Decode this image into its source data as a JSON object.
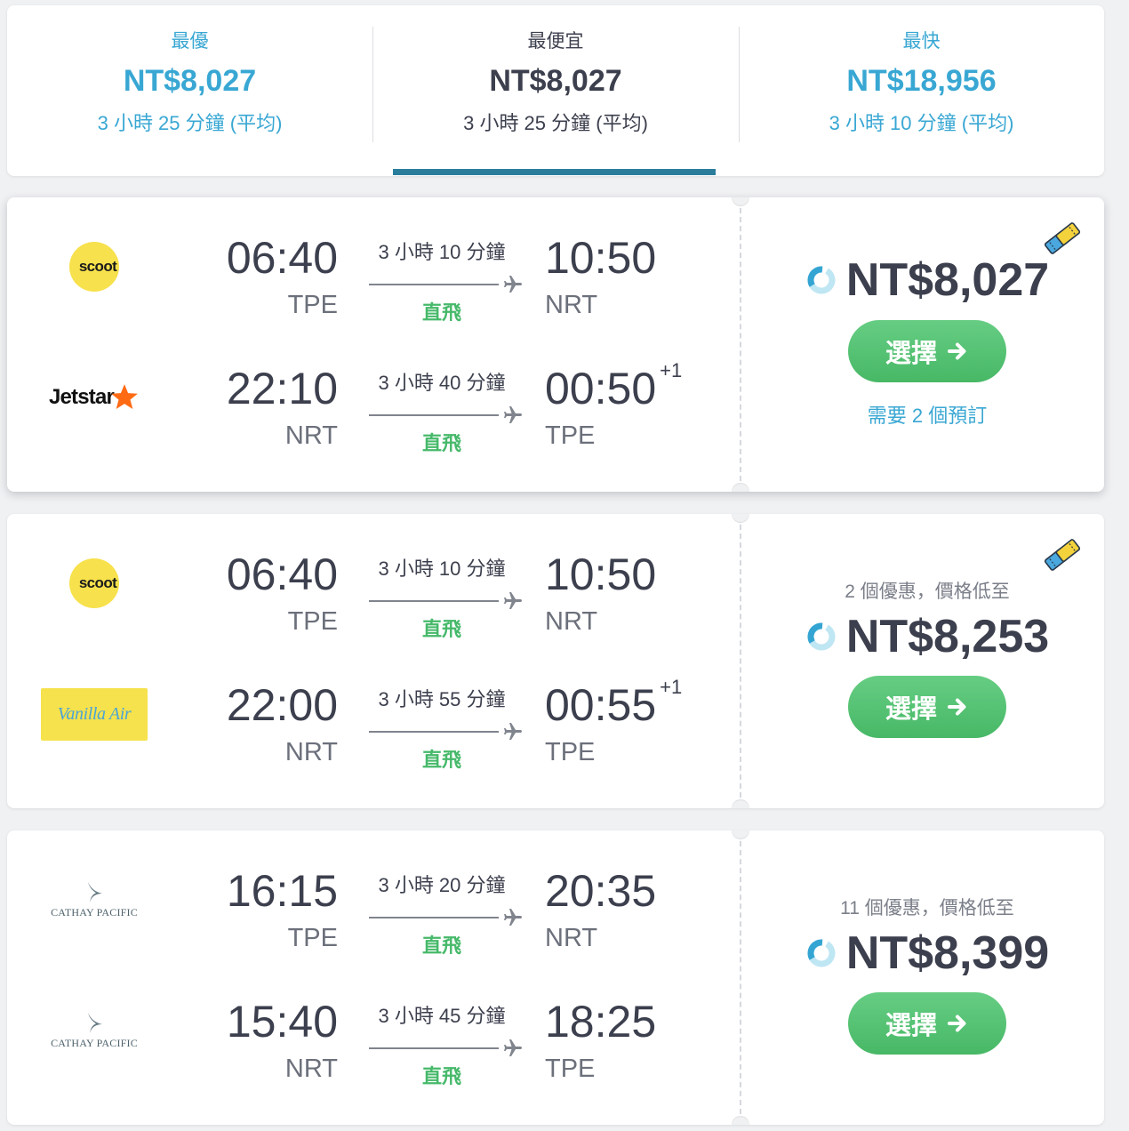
{
  "tabs": [
    {
      "label": "最優",
      "price": "NT$8,027",
      "duration": "3 小時 25 分鐘 (平均)",
      "active": false
    },
    {
      "label": "最便宜",
      "price": "NT$8,027",
      "duration": "3 小時 25 分鐘 (平均)",
      "active": true
    },
    {
      "label": "最快",
      "price": "NT$18,956",
      "duration": "3 小時 10 分鐘 (平均)",
      "active": false
    }
  ],
  "results": [
    {
      "legs": [
        {
          "airline": "scoot",
          "depart_time": "06:40",
          "depart_airport": "TPE",
          "duration": "3 小時 10 分鐘",
          "stops": "直飛",
          "arrive_time": "10:50",
          "arrive_airport": "NRT"
        },
        {
          "airline": "Jetstar",
          "depart_time": "22:10",
          "depart_airport": "NRT",
          "duration": "3 小時 40 分鐘",
          "stops": "直飛",
          "arrive_time": "00:50",
          "day_offset": "+1",
          "arrive_airport": "TPE"
        }
      ],
      "price": "NT$8,027",
      "select_label": "選擇",
      "note": "需要 2 個預訂",
      "has_deal_badge": true
    },
    {
      "legs": [
        {
          "airline": "scoot",
          "depart_time": "06:40",
          "depart_airport": "TPE",
          "duration": "3 小時 10 分鐘",
          "stops": "直飛",
          "arrive_time": "10:50",
          "arrive_airport": "NRT"
        },
        {
          "airline": "Vanilla Air",
          "depart_time": "22:00",
          "depart_airport": "NRT",
          "duration": "3 小時 55 分鐘",
          "stops": "直飛",
          "arrive_time": "00:55",
          "day_offset": "+1",
          "arrive_airport": "TPE"
        }
      ],
      "deals_text": "2 個優惠，價格低至",
      "price": "NT$8,253",
      "select_label": "選擇",
      "has_deal_badge": true
    },
    {
      "legs": [
        {
          "airline": "CATHAY PACIFIC",
          "depart_time": "16:15",
          "depart_airport": "TPE",
          "duration": "3 小時 20 分鐘",
          "stops": "直飛",
          "arrive_time": "20:35",
          "arrive_airport": "NRT"
        },
        {
          "airline": "CATHAY PACIFIC",
          "depart_time": "15:40",
          "depart_airport": "NRT",
          "duration": "3 小時 45 分鐘",
          "stops": "直飛",
          "arrive_time": "18:25",
          "arrive_airport": "TPE"
        }
      ],
      "deals_text": "11 個優惠，價格低至",
      "price": "NT$8,399",
      "select_label": "選擇",
      "has_deal_badge": false
    }
  ],
  "icons": {
    "price_indicator": "ring-icon",
    "select_arrow": "arrow-right-icon",
    "deal_badge": "tickets-icon",
    "flight_direction": "plane-icon",
    "jetstar_star": "star-icon",
    "cathay_mark": "cathay-swoosh-icon"
  },
  "colors": {
    "page_bg": "#f0f1f3",
    "accent_blue": "#39a7d3",
    "text_dark": "#3c3f4d",
    "text_gray": "#6c707b",
    "muted_gray": "#7b7f89",
    "direct_green": "#46b96a",
    "button_green": "#47b866",
    "active_underline": "#2b7d9c",
    "route_line": "#80848d"
  }
}
